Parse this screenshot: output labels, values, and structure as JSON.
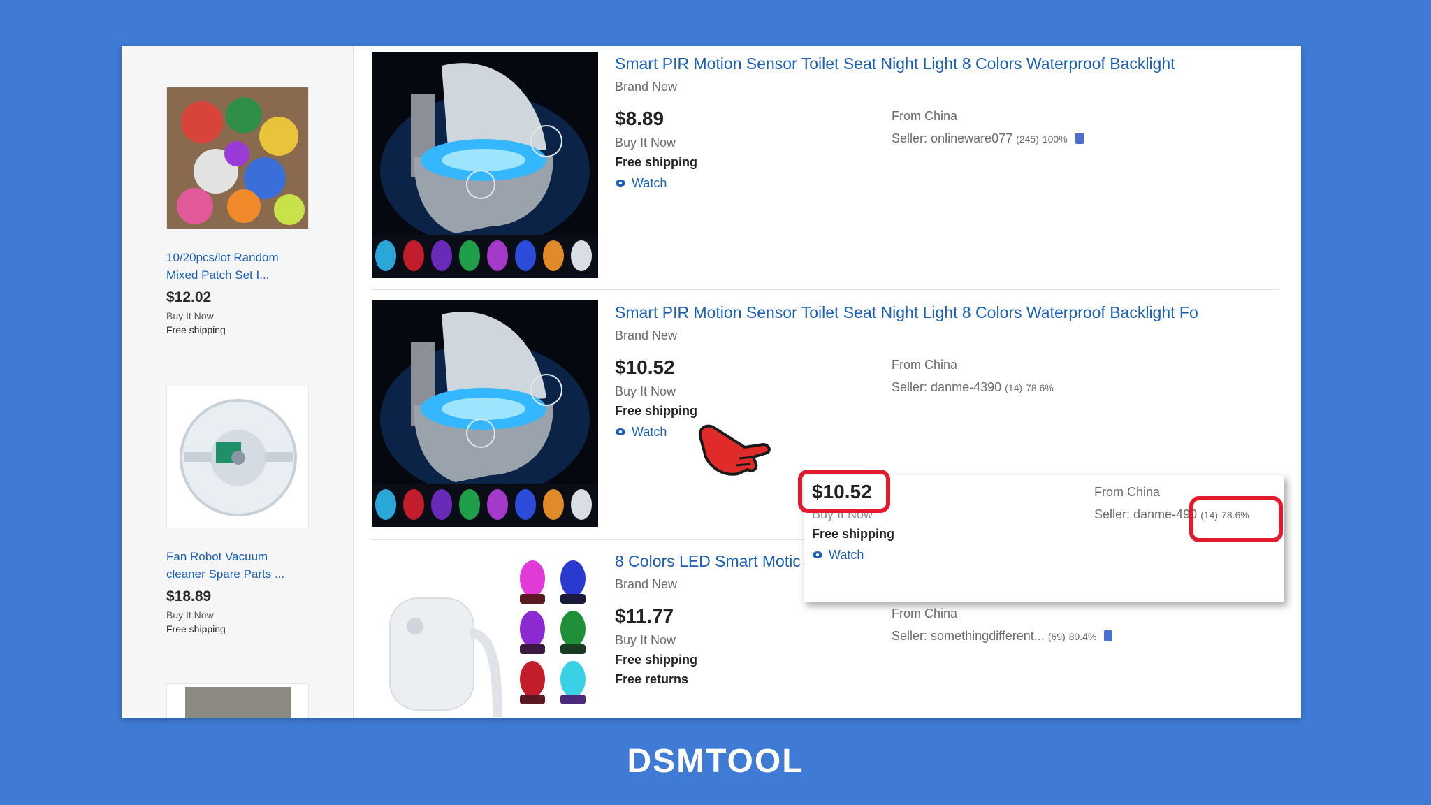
{
  "sidebar": {
    "items": [
      {
        "title_line1": "10/20pcs/lot Random",
        "title_line2": "Mixed Patch Set I...",
        "price": "$12.02",
        "buy": "Buy It Now",
        "shipping": "Free shipping"
      },
      {
        "title_line1": "Fan Robot Vacuum",
        "title_line2": "cleaner Spare Parts ...",
        "price": "$18.89",
        "buy": "Buy It Now",
        "shipping": "Free shipping"
      }
    ]
  },
  "listings": [
    {
      "title": "Smart PIR Motion Sensor Toilet Seat Night Light 8 Colors Waterproof Backlight",
      "condition": "Brand New",
      "price": "$8.89",
      "buy": "Buy It Now",
      "shipping": "Free shipping",
      "watch": "Watch",
      "from": "From China",
      "seller_label": "Seller:",
      "seller_name": "onlineware077",
      "seller_count": "(245)",
      "seller_pct": "100%"
    },
    {
      "title": "Smart PIR Motion Sensor Toilet Seat Night Light 8 Colors Waterproof Backlight Fo",
      "condition": "Brand New",
      "price": "$10.52",
      "buy": "Buy It Now",
      "shipping": "Free shipping",
      "watch": "Watch",
      "from": "From China",
      "seller_label": "Seller:",
      "seller_name": "danme-4390",
      "seller_count": "(14)",
      "seller_pct": "78.6%"
    },
    {
      "title": "8 Colors LED Smart Motic",
      "condition": "Brand New",
      "price": "$11.77",
      "buy": "Buy It Now",
      "shipping": "Free shipping",
      "returns": "Free returns",
      "from": "From China",
      "seller_label": "Seller:",
      "seller_name": "somethingdifferent...",
      "seller_count": "(69)",
      "seller_pct": "89.4%"
    }
  ],
  "callout": {
    "price": "$10.52",
    "buy": "Buy It Now",
    "shipping": "Free shipping",
    "watch": "Watch",
    "from": "From China",
    "seller_name": "Seller: danme-4",
    "seller_tail": "90",
    "seller_count": "(14)",
    "seller_pct": "78.6%"
  },
  "logo": "DSMTOOL",
  "colors": {
    "background": "#3f7bd4",
    "link": "#1a5fb4",
    "highlight": "#e21a2b"
  }
}
